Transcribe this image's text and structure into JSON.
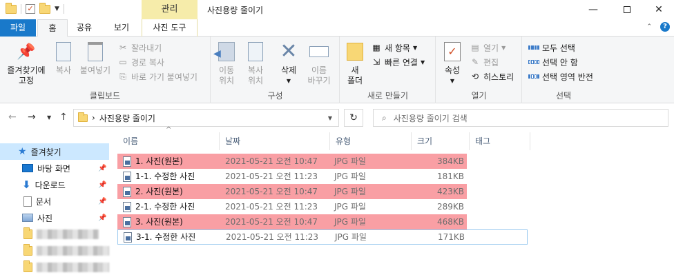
{
  "window": {
    "title": "사진용량 줄이기",
    "context_tab_group": "관리"
  },
  "ribbon_tabs": [
    {
      "label": "파일"
    },
    {
      "label": "홈"
    },
    {
      "label": "공유"
    },
    {
      "label": "보기"
    },
    {
      "label": "사진 도구"
    }
  ],
  "ribbon": {
    "clipboard": {
      "label": "클립보드",
      "pin_quick": "즐겨찾기에\n고정",
      "copy": "복사",
      "paste": "붙여넣기",
      "cut": "잘라내기",
      "copy_path": "경로 복사",
      "paste_shortcut": "바로 가기 붙여넣기"
    },
    "organize": {
      "label": "구성",
      "move_to": "이동\n위치",
      "copy_to": "복사\n위치",
      "delete": "삭제",
      "rename": "이름\n바꾸기"
    },
    "new": {
      "label": "새로 만들기",
      "new_folder": "새\n폴더",
      "new_item": "새 항목",
      "easy_access": "빠른 연결"
    },
    "open": {
      "label": "열기",
      "properties": "속성",
      "open": "열기",
      "edit": "편집",
      "history": "히스토리"
    },
    "select": {
      "label": "선택",
      "select_all": "모두 선택",
      "select_none": "선택 안 함",
      "invert": "선택 영역 반전"
    }
  },
  "address": {
    "path": "사진용량 줄이기",
    "search_placeholder": "사진용량 줄이기 검색"
  },
  "nav_pane": {
    "quick_access": "즐겨찾기",
    "items": [
      {
        "label": "바탕 화면"
      },
      {
        "label": "다운로드"
      },
      {
        "label": "문서"
      },
      {
        "label": "사진"
      }
    ]
  },
  "columns": {
    "name": "이름",
    "date": "날짜",
    "type": "유형",
    "size": "크기",
    "tags": "태그"
  },
  "files": [
    {
      "name": "1. 사진(원본)",
      "date": "2021-05-21 오전 10:47",
      "type": "JPG 파일",
      "size": "384KB",
      "highlight": true
    },
    {
      "name": "1-1. 수정한 사진",
      "date": "2021-05-21 오전 11:23",
      "type": "JPG 파일",
      "size": "181KB",
      "highlight": false
    },
    {
      "name": "2. 사진(원본)",
      "date": "2021-05-21 오전 10:47",
      "type": "JPG 파일",
      "size": "423KB",
      "highlight": true
    },
    {
      "name": "2-1. 수정한 사진",
      "date": "2021-05-21 오전 11:23",
      "type": "JPG 파일",
      "size": "289KB",
      "highlight": false
    },
    {
      "name": "3. 사진(원본)",
      "date": "2021-05-21 오전 10:47",
      "type": "JPG 파일",
      "size": "468KB",
      "highlight": true
    },
    {
      "name": "3-1. 수정한 사진",
      "date": "2021-05-21 오전 11:23",
      "type": "JPG 파일",
      "size": "171KB",
      "highlight": false
    }
  ],
  "colors": {
    "accent": "#1979ca",
    "highlight": "#f99fa4",
    "context_tab": "#f6ecaa",
    "nav_selected": "#cce8ff"
  }
}
